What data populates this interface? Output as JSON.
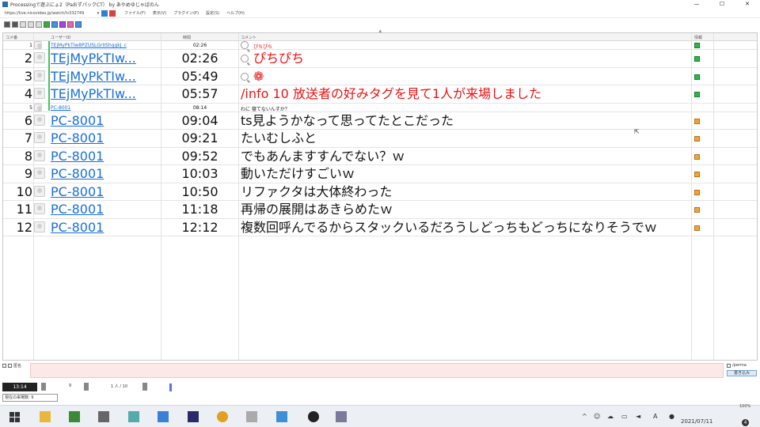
{
  "window": {
    "title": "Processingで遊ぶにょ2（PaおずパックCT） by あやめゆじゃぱのん",
    "url": "https://live.nicovideo.jp/watch/lv332749",
    "menu": [
      "ファイル(F)",
      "表示(V)",
      "プラグイン(P)",
      "設定(S)",
      "ヘルプ(H)"
    ],
    "controls": [
      "—",
      "☐",
      "✕"
    ]
  },
  "grid": {
    "headers": {
      "num": "コメ番",
      "user": "ユーザーID",
      "time": "時間",
      "comment": "コメント",
      "info": "情報"
    },
    "rows": [
      {
        "num": "1",
        "user": "TEjMyPkTIw8PZUSLGrIIShggkJ_c",
        "time": "02:26",
        "comment": "ぴちぴち",
        "comment_red": true,
        "icon": true,
        "flag": "green",
        "size": "small"
      },
      {
        "num": "2",
        "user": "TEjMyPkTIw...",
        "time": "02:26",
        "comment": "ぴちぴち",
        "comment_red": true,
        "icon": true,
        "flag": "green",
        "size": "big"
      },
      {
        "num": "3",
        "user": "TEjMyPkTIw...",
        "time": "05:49",
        "comment": "❁",
        "comment_red": true,
        "icon": true,
        "flag": "green",
        "size": "big"
      },
      {
        "num": "4",
        "user": "TEjMyPkTIw...",
        "time": "05:57",
        "comment": "/info 10 放送者の好みタグを見て1人が来場しました",
        "comment_red": true,
        "icon": false,
        "flag": "green",
        "size": "big"
      },
      {
        "num": "5",
        "user": "PC-8001",
        "time": "08:14",
        "comment": "わに 寝てないんすか？",
        "comment_red": false,
        "icon": false,
        "flag": "",
        "size": "small"
      },
      {
        "num": "6",
        "user": "PC-8001",
        "time": "09:04",
        "comment": "ts見ようかなって思ってたとこだった",
        "comment_red": false,
        "icon": false,
        "flag": "orange",
        "size": "big"
      },
      {
        "num": "7",
        "user": "PC-8001",
        "time": "09:21",
        "comment": "たいむしふと",
        "comment_red": false,
        "icon": false,
        "flag": "orange",
        "size": "big"
      },
      {
        "num": "8",
        "user": "PC-8001",
        "time": "09:52",
        "comment": "でもあんますすんでない？ｗ",
        "comment_red": false,
        "icon": false,
        "flag": "orange",
        "size": "big"
      },
      {
        "num": "9",
        "user": "PC-8001",
        "time": "10:03",
        "comment": "動いただけすごいｗ",
        "comment_red": false,
        "icon": false,
        "flag": "orange",
        "size": "big"
      },
      {
        "num": "10",
        "user": "PC-8001",
        "time": "10:50",
        "comment": "リファクタは大体終わった",
        "comment_red": false,
        "icon": false,
        "flag": "orange",
        "size": "big"
      },
      {
        "num": "11",
        "user": "PC-8001",
        "time": "11:18",
        "comment": "再帰の展開はあきらめたｗ",
        "comment_red": false,
        "icon": false,
        "flag": "orange",
        "size": "big"
      },
      {
        "num": "12",
        "user": "PC-8001",
        "time": "12:12",
        "comment": "複数回呼んでるからスタックいるだろうしどっちもどっちになりそうでｗ",
        "comment_red": false,
        "icon": false,
        "flag": "orange",
        "size": "big"
      }
    ]
  },
  "input": {
    "anon_label": "匿名",
    "name_label": "/perma",
    "send_label": "書き込み"
  },
  "status": {
    "elapsed": "13:14",
    "count_a": "9",
    "count_b": "8",
    "count_c": "1 人 / 10",
    "select_value": "現在の来場数: 9"
  },
  "taskbar": {
    "time": "",
    "date": "2021/07/11",
    "notifications": "4",
    "zoom": "100%"
  }
}
